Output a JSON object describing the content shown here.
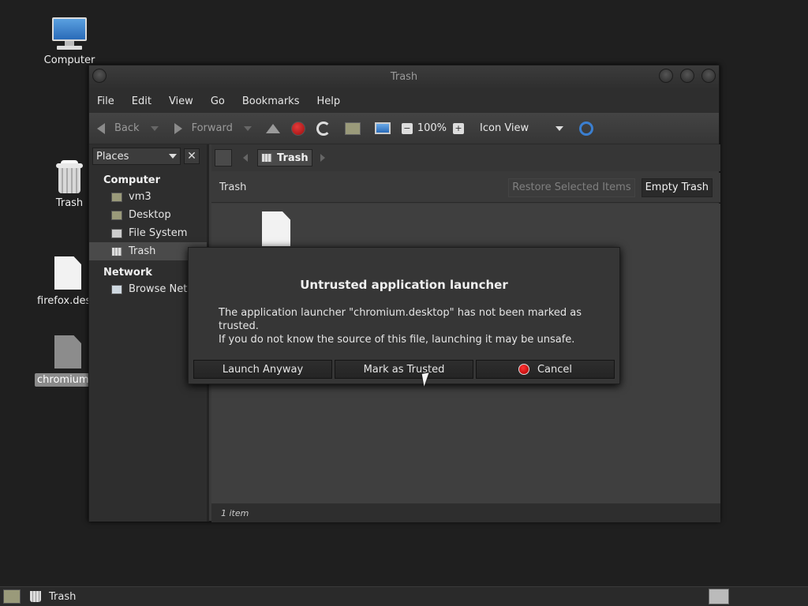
{
  "desktop": {
    "icons": [
      {
        "label": "Computer"
      },
      {
        "label": "Trash"
      },
      {
        "label": "firefox.desktop"
      },
      {
        "label": "chromium.desktop"
      }
    ]
  },
  "window": {
    "title": "Trash",
    "menu": [
      "File",
      "Edit",
      "View",
      "Go",
      "Bookmarks",
      "Help"
    ],
    "toolbar": {
      "back": "Back",
      "forward": "Forward",
      "zoom": "100%",
      "view_mode": "Icon View"
    },
    "sidebar": {
      "selector": "Places",
      "sections": [
        {
          "title": "Computer",
          "items": [
            "vm3",
            "Desktop",
            "File System",
            "Trash"
          ]
        },
        {
          "title": "Network",
          "items": [
            "Browse Network"
          ]
        }
      ]
    },
    "pathbar": {
      "crumb": "Trash"
    },
    "location": {
      "label": "Trash",
      "restore_button": "Restore Selected Items",
      "empty_button": "Empty Trash"
    },
    "status": "1 item"
  },
  "dialog": {
    "title": "Untrusted application launcher",
    "message_line1": "The application launcher \"chromium.desktop\" has not been marked as trusted.",
    "message_line2": "If you do not know the source of this file, launching it may be unsafe.",
    "buttons": {
      "launch": "Launch Anyway",
      "trust": "Mark as Trusted",
      "cancel": "Cancel"
    }
  },
  "taskbar": {
    "task": "Trash"
  }
}
